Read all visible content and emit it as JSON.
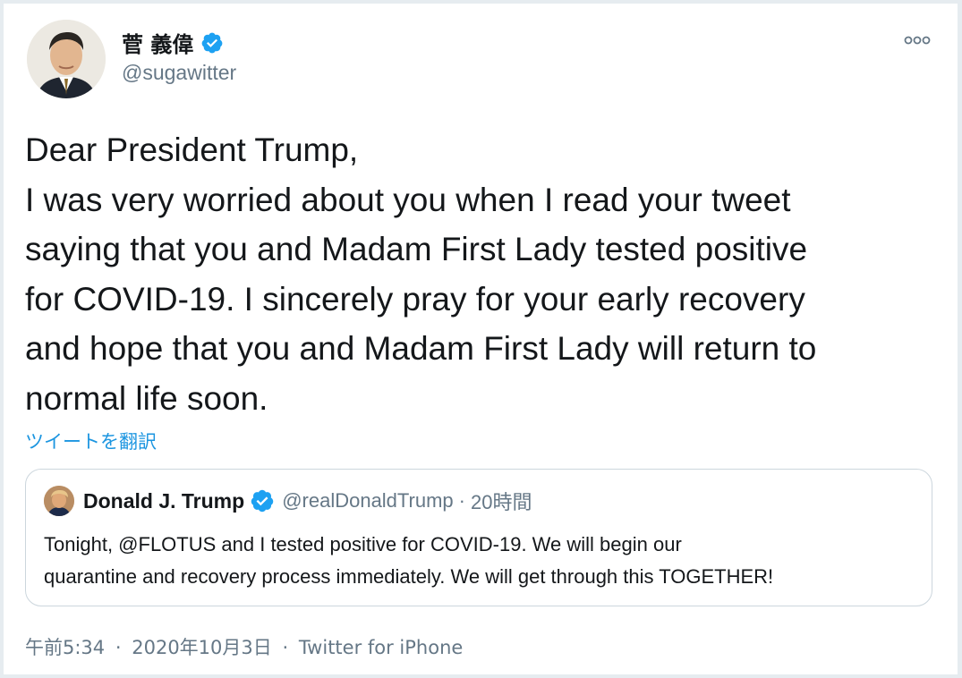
{
  "author": {
    "display_name": "菅 義偉",
    "handle": "@sugawitter",
    "verified": true
  },
  "tweet": {
    "text": "Dear President Trump,\nI was very worried about you when I read your tweet\nsaying that you and Madam First Lady tested positive\nfor COVID-19. I sincerely pray for your early recovery\nand hope that you and Madam First Lady will return to\nnormal life soon.",
    "translate_label": "ツイートを翻訳"
  },
  "quoted_tweet": {
    "display_name": "Donald J. Trump",
    "handle": "@realDonaldTrump",
    "separator": "·",
    "time": "20時間",
    "text": "Tonight, @FLOTUS and I tested positive for COVID-19. We will begin our\nquarantine and recovery process immediately. We will get through this TOGETHER!"
  },
  "meta": {
    "time": "午前5:34",
    "separator": "·",
    "date": "2020年10月3日",
    "source": "Twitter for iPhone"
  },
  "icons": {
    "verified": "verified-badge-icon",
    "more": "more-options-icon"
  },
  "colors": {
    "accent": "#1da1f2",
    "link": "#1b95e0",
    "secondary_text": "#657786",
    "border": "#ccd6dd"
  }
}
